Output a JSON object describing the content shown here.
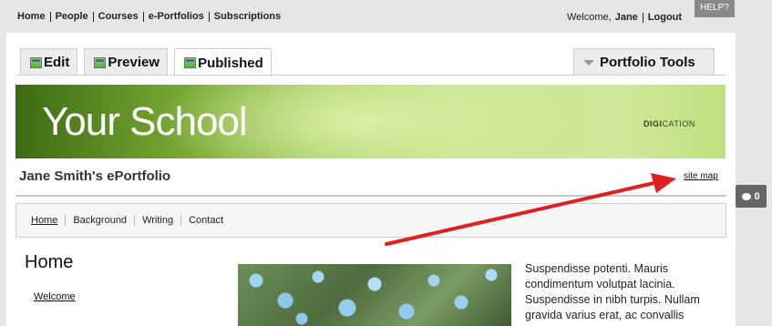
{
  "topnav": {
    "links": [
      "Home",
      "People",
      "Courses",
      "e-Portfolios",
      "Subscriptions"
    ],
    "welcome_prefix": "Welcome,",
    "user": "Jane",
    "logout": "Logout",
    "help": "HELP?"
  },
  "tabs": [
    {
      "label": "Edit",
      "icon": "edit-icon"
    },
    {
      "label": "Preview",
      "icon": "preview-icon"
    },
    {
      "label": "Published",
      "icon": "published-icon",
      "active": true
    }
  ],
  "portfolio_tools": "Portfolio Tools",
  "banner": {
    "school": "Your School",
    "brand_bold": "DIGI",
    "brand_rest": "CATION"
  },
  "portfolio": {
    "title": "Jane Smith's ePortfolio",
    "site_map": "site map"
  },
  "nav": [
    "Home",
    "Background",
    "Writing",
    "Contact"
  ],
  "page": {
    "heading": "Home",
    "sidebar_link": "Welcome",
    "body": "Suspendisse potenti. Mauris condimentum volutpat lacinia. Suspendisse in nibh turpis. Nullam gravida varius erat, ac convallis"
  },
  "comments": {
    "count": "0"
  },
  "colors": {
    "arrow": "#e02020",
    "banner": "#a8cf5e"
  }
}
